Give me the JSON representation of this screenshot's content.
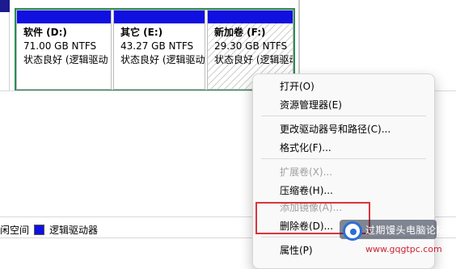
{
  "volumes": [
    {
      "name": "软件 (D:)",
      "size": "71.00 GB NTFS",
      "status": "状态良好 (逻辑驱动"
    },
    {
      "name": "其它 (E:)",
      "size": "43.27 GB NTFS",
      "status": "状态良好 (逻辑驱动"
    },
    {
      "name": "新加卷 (F:)",
      "size": "29.30 GB NTFS",
      "status": "状态良好 (逻辑驱动"
    }
  ],
  "legend": {
    "free_space": "闲空间",
    "logical_drive": "逻辑驱动器"
  },
  "menu": {
    "open": "打开(O)",
    "explorer": "资源管理器(E)",
    "change_letter": "更改驱动器号和路径(C)...",
    "format": "格式化(F)...",
    "extend": "扩展卷(X)...",
    "shrink": "压缩卷(H)...",
    "add_mirror": "添加镜像(A)...",
    "delete": "删除卷(D)...",
    "properties": "属性(P)"
  },
  "watermark": {
    "title": "过期馒头电脑论坛",
    "url": "www.gqgtpc.com"
  },
  "colors": {
    "volume_header": "#1010e0",
    "group_border": "#2e8b57",
    "highlight": "#d9363e"
  }
}
